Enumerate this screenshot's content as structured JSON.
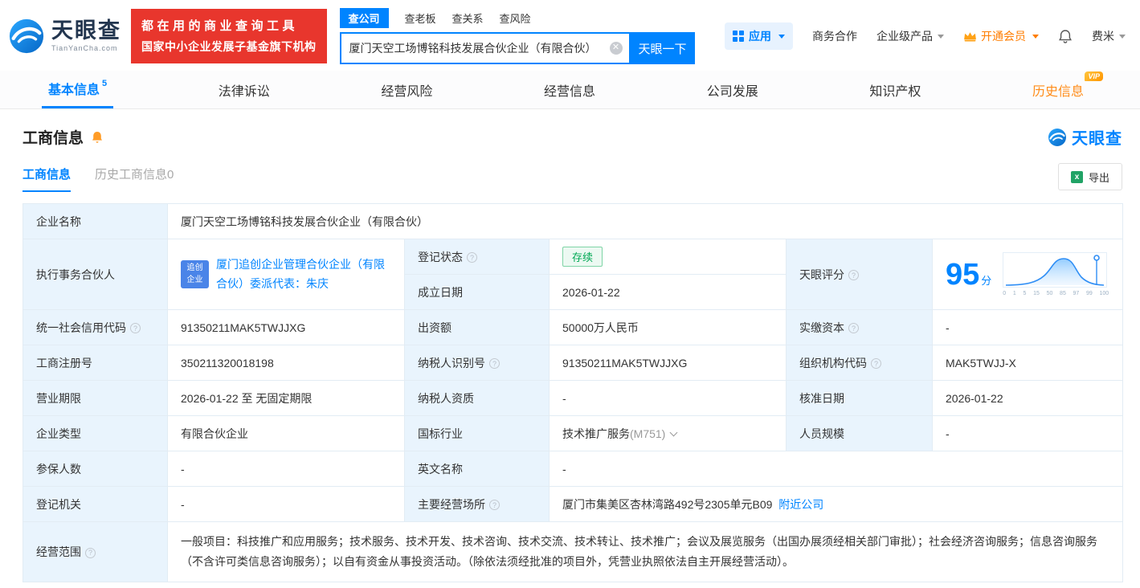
{
  "header": {
    "logo": {
      "name": "天眼查",
      "domain": "TianYanCha.com"
    },
    "promo": {
      "line1": "都在用的商业查询工具",
      "line2": "国家中小企业发展子基金旗下机构"
    },
    "search": {
      "tabs": [
        {
          "label": "查公司"
        },
        {
          "label": "查老板"
        },
        {
          "label": "查关系"
        },
        {
          "label": "查风险"
        }
      ],
      "value": "厦门天空工场博铭科技发展合伙企业（有限合伙）",
      "button": "天眼一下"
    },
    "right": {
      "apps": "应用",
      "cooperation": "商务合作",
      "enterprise": "企业级产品",
      "vip": "开通会员",
      "user": "费米"
    }
  },
  "nav": {
    "tabs": [
      {
        "label": "基本信息",
        "count": "5"
      },
      {
        "label": "法律诉讼"
      },
      {
        "label": "经营风险"
      },
      {
        "label": "经营信息"
      },
      {
        "label": "公司发展"
      },
      {
        "label": "知识产权"
      },
      {
        "label": "历史信息",
        "vip": "VIP"
      }
    ]
  },
  "section": {
    "title": "工商信息",
    "brand": "天眼查",
    "sub_tabs": [
      {
        "label": "工商信息"
      },
      {
        "label": "历史工商信息0"
      }
    ],
    "export": "导出"
  },
  "info": {
    "company_name_label": "企业名称",
    "company_name": "厦门天空工场博铭科技发展合伙企业（有限合伙）",
    "partner_label": "执行事务合伙人",
    "partner_badge_top": "追创",
    "partner_badge_bottom": "企业",
    "partner_value": "厦门追创企业管理合伙企业（有限合伙）委派代表：朱庆",
    "reg_status_label": "登记状态",
    "reg_status_value": "存续",
    "score_label": "天眼评分",
    "score_value": "95",
    "score_unit": "分",
    "score_axis": [
      "0",
      "1",
      "5",
      "15",
      "50",
      "85",
      "97",
      "99",
      "100"
    ],
    "establish_label": "成立日期",
    "establish_value": "2026-01-22",
    "credit_code_label": "统一社会信用代码",
    "credit_code_value": "91350211MAK5TWJJXG",
    "capital_label": "出资额",
    "capital_value": "50000万人民币",
    "paid_in_label": "实缴资本",
    "paid_in_value": "-",
    "reg_no_label": "工商注册号",
    "reg_no_value": "350211320018198",
    "taxpayer_no_label": "纳税人识别号",
    "taxpayer_no_value": "91350211MAK5TWJJXG",
    "org_code_label": "组织机构代码",
    "org_code_value": "MAK5TWJJ-X",
    "term_label": "营业期限",
    "term_value": "2026-01-22 至 无固定期限",
    "taxpayer_cred_label": "纳税人资质",
    "taxpayer_cred_value": "-",
    "approve_label": "核准日期",
    "approve_value": "2026-01-22",
    "type_label": "企业类型",
    "type_value": "有限合伙企业",
    "industry_label": "国标行业",
    "industry_value": "技术推广服务",
    "industry_code": "(M751)",
    "staff_label": "人员规模",
    "staff_value": "-",
    "insured_label": "参保人数",
    "insured_value": "-",
    "en_name_label": "英文名称",
    "en_name_value": "-",
    "authority_label": "登记机关",
    "authority_value": "-",
    "premises_label": "主要经营场所",
    "premises_value": "厦门市集美区杏林湾路492号2305单元B09",
    "premises_link": "附近公司",
    "scope_label": "经营范围",
    "scope_value": "一般项目：科技推广和应用服务；技术服务、技术开发、技术咨询、技术交流、技术转让、技术推广；会议及展览服务（出国办展须经相关部门审批）；社会经济咨询服务；信息咨询服务（不含许可类信息咨询服务）；以自有资金从事投资活动。（除依法须经批准的项目外，凭营业执照依法自主开展经营活动）。"
  }
}
